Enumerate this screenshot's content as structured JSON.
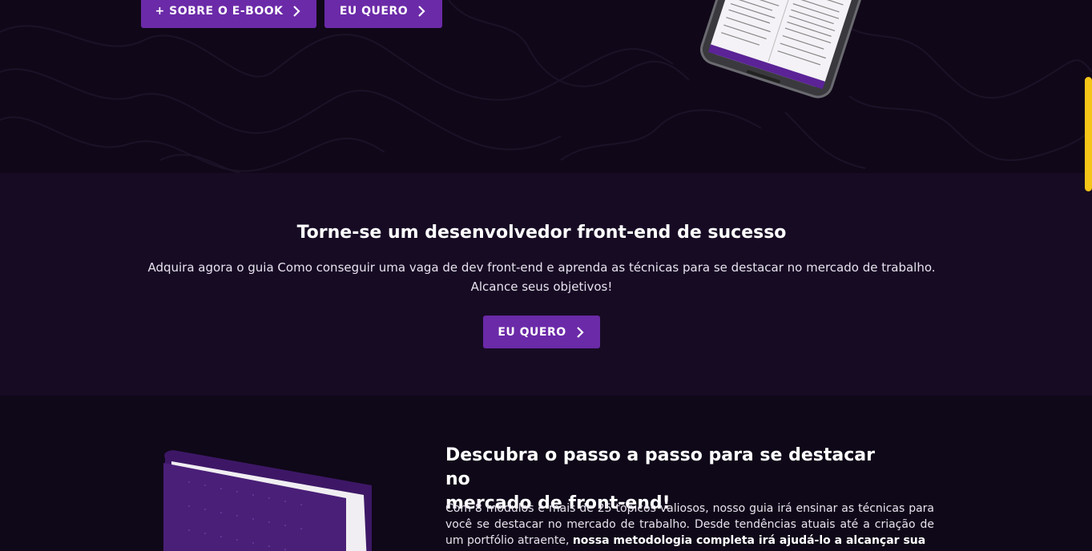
{
  "hero": {
    "sobre_label": "+ SOBRE O E-BOOK",
    "quero_label": "EU QUERO"
  },
  "cta": {
    "title": "Torne-se um desenvolvedor front-end de sucesso",
    "line1": "Adquira agora o guia Como conseguir uma vaga de dev front-end e aprenda as técnicas para se destacar no mercado de trabalho.",
    "line2": "Alcance seus objetivos!",
    "button_label": "EU QUERO"
  },
  "features": {
    "title_line1": "Descubra o passo a passo para se destacar no",
    "title_line2": "mercado de front-end!",
    "text_plain": "Com 8 módulos e mais de 25 tópicos valiosos, nosso guia irá ensinar as técnicas para você se destacar no mercado de trabalho. Desde tendências atuais até a criação de um portfólio atraente,",
    "text_bold": "nossa metodologia completa irá ajudá-lo a alcançar sua"
  },
  "colors": {
    "accent": "#6b2aa8",
    "background": "#0f0818",
    "section": "#170b24",
    "scrollbar": "#f5c518"
  },
  "icons": [
    "chevron-right-icon"
  ]
}
